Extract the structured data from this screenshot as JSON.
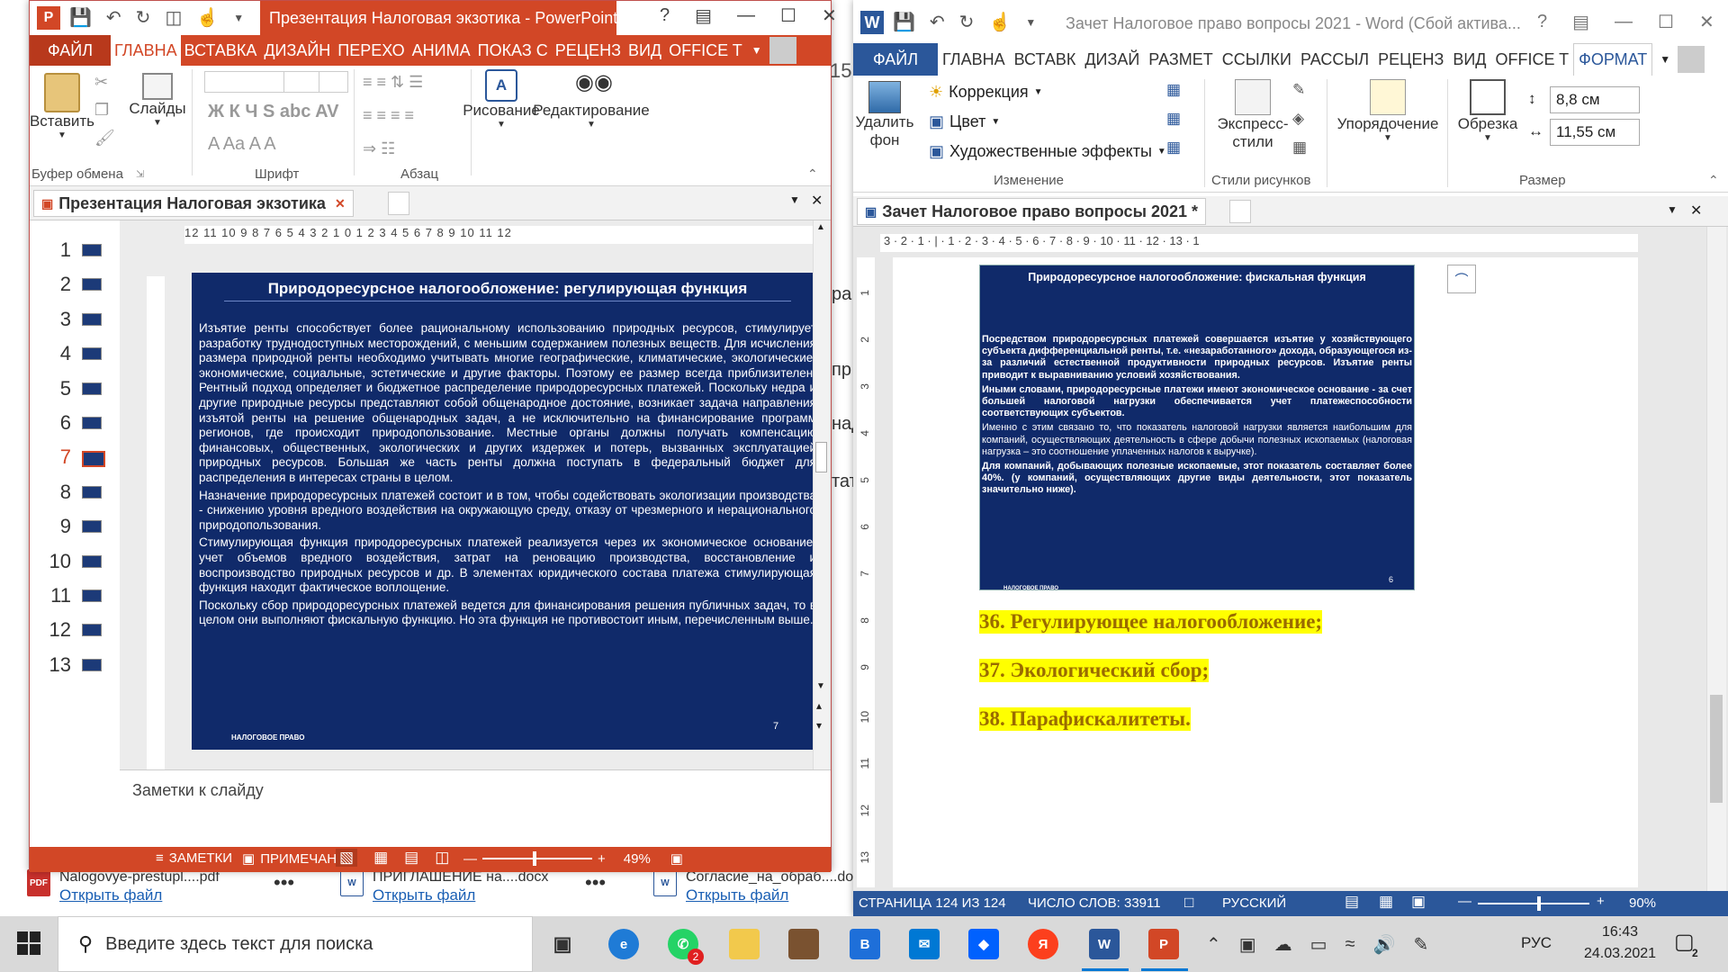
{
  "downloads": [
    {
      "name": "Nalogovye-prestupl....pdf",
      "action": "Открыть файл",
      "type": "PDF"
    },
    {
      "name": "ПРИГЛАШЕНИЕ на....docx",
      "action": "Открыть файл",
      "type": "W"
    },
    {
      "name": "Согласие_на_обраб....docx",
      "action": "Открыть файл",
      "type": "W"
    }
  ],
  "behind_fragments": [
    "15",
    "ра",
    "пр",
    "над",
    "тату"
  ],
  "powerpoint": {
    "app_icon": "P",
    "title": "Презентация Налоговая экзотика - PowerPoint (...",
    "tabs": [
      "ФАЙЛ",
      "ГЛАВНА",
      "ВСТАВКА",
      "ДИЗАЙН",
      "ПЕРЕХО",
      "АНИМА",
      "ПОКАЗ С",
      "РЕЦЕНЗ",
      "ВИД",
      "OFFICE T"
    ],
    "ribbon": {
      "paste": "Вставить",
      "slides": "Слайды",
      "drawing": "Рисование",
      "editing": "Редактирование",
      "groups": [
        "Буфер обмена",
        "Шрифт",
        "Абзац"
      ],
      "font_row1": "Ж К Ч S abc AV",
      "font_row2": "A  Aa  A A"
    },
    "doc_tab": "Презентация Налоговая экзотика",
    "slide_numbers": [
      "1",
      "2",
      "3",
      "4",
      "5",
      "6",
      "7",
      "8",
      "9",
      "10",
      "11",
      "12",
      "13"
    ],
    "current_slide": "7",
    "ruler": "12 11 10 9 8 7 6 5 4 3 2 1 0 1 2 3 4 5 6 7 8 9 10 11 12",
    "slide": {
      "title": "Природоресурсное налогообложение: регулирующая функция",
      "paragraphs": [
        "Изъятие ренты способствует более рациональному использованию природных ресурсов, стимулирует разработку труднодоступных месторождений, с меньшим содержанием полезных веществ. Для исчисления размера природной ренты необходимо учитывать многие географические, климатические, экологические, экономические, социальные, эстетические и другие факторы. Поэтому ее размер всегда приблизителен. Рентный подход определяет и бюджетное распределение природоресурсных платежей. Поскольку недра и другие природные ресурсы представляют собой общенародное достояние, возникает задача направления изъятой ренты на решение общенародных задач, а не исключительно на финансирование программ регионов, где происходит природопользование. Местные органы должны получать компенсацию финансовых, общественных, экологических и других издержек и потерь, вызванных эксплуатацией природных ресурсов. Большая же часть ренты должна поступать в федеральный бюджет для распределения в интересах страны в целом.",
        "Назначение природоресурсных платежей состоит и в том, чтобы содействовать экологизации производства - снижению уровня вредного воздействия на окружающую среду, отказу от чрезмерного и нерационального природопользования.",
        "Стимулирующая функция природоресурсных платежей реализуется через их экономическое основание: учет объемов вредного воздействия, затрат на реновацию производства, восстановление и воспроизводство природных ресурсов и др. В элементах юридического состава платежа стимулирующая функция находит фактическое воплощение.",
        "Поскольку сбор природоресурсных платежей ведется для финансирования решения публичных задач, то в целом они выполняют фискальную функцию. Но эта функция не противостоит иным, перечисленным выше."
      ],
      "footer": "НАЛОГОВОЕ ПРАВО",
      "page": "7"
    },
    "notes_placeholder": "Заметки к слайду",
    "status": {
      "notes": "ЗАМЕТКИ",
      "comments": "ПРИМЕЧАНИЯ",
      "zoom": "49%"
    }
  },
  "word": {
    "app_icon": "W",
    "title": "Зачет Налоговое право вопросы 2021 - Word (Сбой актива...",
    "tabs": [
      "ФАЙЛ",
      "ГЛАВНА",
      "ВСТАВК",
      "ДИЗАЙ",
      "РАЗМЕТ",
      "ССЫЛКИ",
      "РАССЫЛ",
      "РЕЦЕНЗ",
      "ВИД",
      "OFFICE T",
      "ФОРМАТ"
    ],
    "ribbon": {
      "remove_bg": "Удалить фон",
      "correction": "Коррекция",
      "color": "Цвет",
      "artistic": "Художественные эффекты",
      "change_group": "Изменение",
      "express_styles": "Экспресс-стили",
      "styles_group": "Стили рисунков",
      "arrange": "Упорядочение",
      "crop": "Обрезка",
      "height": "8,8 см",
      "width": "11,55 см",
      "size_group": "Размер"
    },
    "doc_tab": "Зачет Налоговое право вопросы 2021 *",
    "ruler": "3 · 2 · 1 · | · 1 · 2 · 3 · 4 · 5 · 6 · 7 · 8 · 9 · 10 · 11 · 12 · 13 · 1",
    "vruler": [
      "1",
      "2",
      "3",
      "4",
      "5",
      "6",
      "7",
      "8",
      "9",
      "10",
      "11",
      "12",
      "13"
    ],
    "slide": {
      "title": "Природоресурсное налогообложение: фискальная функция",
      "paragraphs": [
        "Посредством природоресурсных платежей совершается изъятие у хозяйствующего субъекта дифференциальной ренты, т.е. «незаработанного» дохода, образующегося из-за различий естественной продуктивности природных ресурсов. Изъятие ренты приводит к выравниванию условий хозяйствования.",
        "Иными словами, природоресурсные платежи имеют экономическое основание - за счет большей налоговой нагрузки обеспечивается учет платежеспособности соответствующих субъектов.",
        "Именно с этим связано то, что показатель налоговой нагрузки является наибольшим для компаний, осуществляющих деятельность в сфере добычи полезных ископаемых (налоговая нагрузка – это соотношение уплаченных налогов к выручке).",
        "Для компаний, добывающих полезные ископаемые, этот показатель составляет более 40%. (у компаний, осуществляющих другие виды деятельности, этот показатель значительно ниже)."
      ],
      "footer": "НАЛОГОВОЕ ПРАВО",
      "page": "6"
    },
    "items": [
      "36. Регулирующее налогообложение;",
      "37. Экологический сбор;",
      "38. Парафискалитеты."
    ],
    "status": {
      "page": "СТРАНИЦА 124 ИЗ 124",
      "words": "ЧИСЛО СЛОВ: 33911",
      "lang": "РУССКИЙ",
      "zoom": "90%"
    }
  },
  "taskbar": {
    "search_placeholder": "Введите здесь текст для поиска",
    "whatsapp_badge": "2",
    "notif_badge": "2",
    "lang": "РУС",
    "time": "16:43",
    "date": "24.03.2021"
  }
}
